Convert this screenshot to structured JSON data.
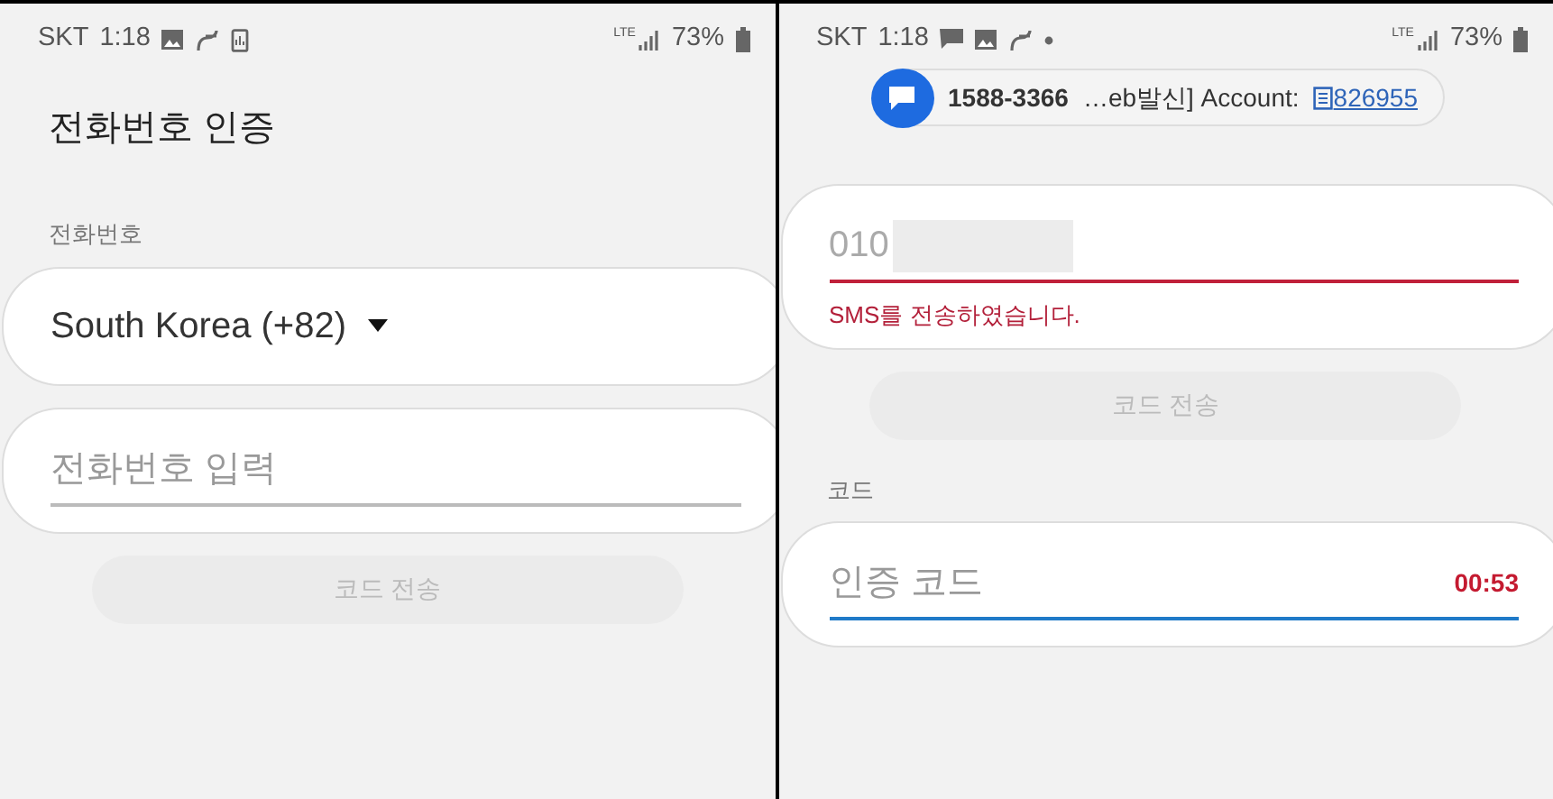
{
  "screens": [
    {
      "status_bar": {
        "carrier": "SKT",
        "time": "1:18",
        "icons": [
          {
            "kind": "picture"
          },
          {
            "kind": "link"
          },
          {
            "kind": "phone"
          }
        ],
        "network": "LTE",
        "battery": "73%"
      },
      "title": "전화번호 인증",
      "fields": [
        {
          "kind": "label",
          "text": "전화번호"
        },
        {
          "kind": "select",
          "value": "South Korea (+82)"
        },
        {
          "kind": "input",
          "placeholder": "전화번호 입력",
          "error": false,
          "focused": false
        },
        {
          "kind": "button",
          "text": "코드 전송",
          "disabled": true
        }
      ]
    },
    {
      "status_bar": {
        "carrier": "SKT",
        "time": "1:18",
        "icons": [
          {
            "kind": "chat"
          },
          {
            "kind": "picture"
          },
          {
            "kind": "link"
          },
          {
            "kind": "dot"
          }
        ],
        "network": "LTE",
        "battery": "73%"
      },
      "notification": {
        "sender": "1588-3366",
        "text": "…eb발신] Account:",
        "code": "826955"
      },
      "fields": [
        {
          "kind": "input",
          "value": "010",
          "redacted": true,
          "error": true,
          "focused": false,
          "helper": "SMS를 전송하였습니다."
        },
        {
          "kind": "button",
          "text": "코드 전송",
          "disabled": true
        },
        {
          "kind": "label",
          "text": "코드"
        },
        {
          "kind": "input",
          "placeholder": "인증 코드",
          "error": false,
          "focused": true,
          "timer": "00:53"
        }
      ]
    }
  ]
}
